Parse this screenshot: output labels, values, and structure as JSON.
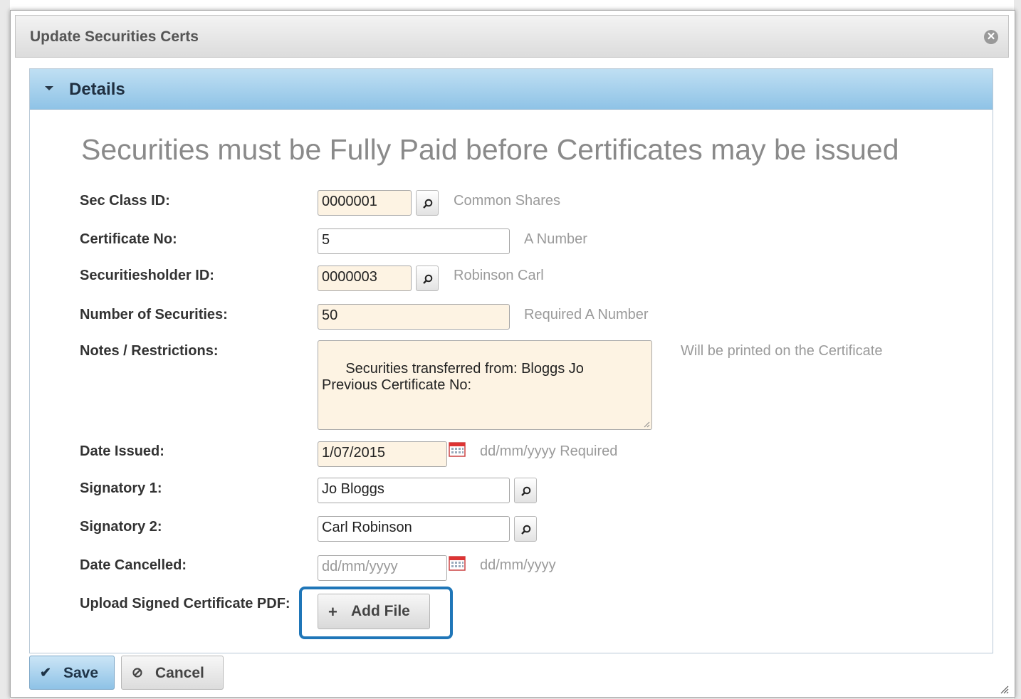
{
  "dialog": {
    "title": "Update Securities Certs",
    "close_glyph": "✕"
  },
  "panel": {
    "title": "Details",
    "notice": "Securities must be Fully Paid before Certificates may be issued"
  },
  "fields": {
    "sec_class": {
      "label": "Sec Class ID:",
      "value": "0000001",
      "hint": "Common Shares"
    },
    "certificate_no": {
      "label": "Certificate No:",
      "value": "5",
      "hint": "A Number"
    },
    "holder": {
      "label": "Securitiesholder ID:",
      "value": "0000003",
      "hint": "Robinson Carl"
    },
    "num_securities": {
      "label": "Number of Securities:",
      "value": "50",
      "hint": "Required A Number"
    },
    "notes": {
      "label": "Notes / Restrictions:",
      "value": "Securities transferred from: Bloggs Jo\nPrevious Certificate No:",
      "hint": "Will be printed on the Certificate"
    },
    "date_issued": {
      "label": "Date Issued:",
      "value": "1/07/2015",
      "hint": "dd/mm/yyyy Required"
    },
    "signatory1": {
      "label": "Signatory 1:",
      "value": "Jo Bloggs"
    },
    "signatory2": {
      "label": "Signatory 2:",
      "value": "Carl Robinson"
    },
    "date_cancelled": {
      "label": "Date Cancelled:",
      "placeholder": "dd/mm/yyyy",
      "hint": "dd/mm/yyyy"
    },
    "upload": {
      "label": "Upload Signed Certificate PDF:",
      "button_label": "Add File",
      "button_icon": "+"
    }
  },
  "footer": {
    "save_label": "Save",
    "save_icon": "✔",
    "cancel_label": "Cancel",
    "cancel_icon": "⊘"
  },
  "colors": {
    "header_blue": "#8fc3e6",
    "required_bg": "#fdf3e3",
    "highlight": "#1f76b8"
  }
}
